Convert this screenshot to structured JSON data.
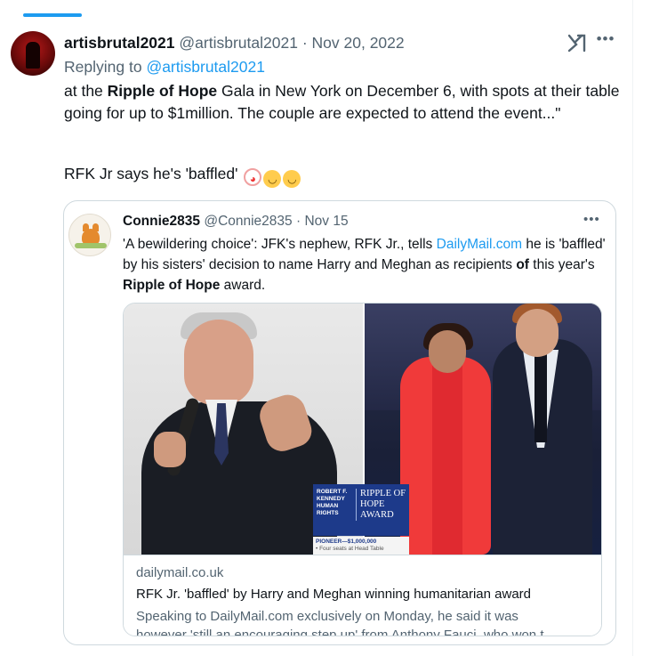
{
  "tweet": {
    "author_name": "artisbrutal2021",
    "author_handle": "@artisbrutal2021",
    "separator": "·",
    "date": "Nov 20, 2022",
    "replying_prefix": "Replying to",
    "replying_handle": "@artisbrutal2021",
    "body_pre": "at the ",
    "body_bold": "Ripple of Hope",
    "body_post": " Gala in New York on December 6, with spots at their table going for up to $1million. The couple are expected to attend the event...\"",
    "line2": "RFK Jr says he's 'baffled'",
    "emojis": [
      "clown-face",
      "grinning-sweat-face",
      "winking-face"
    ],
    "icons": [
      "grok-icon",
      "more-icon"
    ]
  },
  "quote": {
    "author_name": "Connie2835",
    "author_handle": "@Connie2835",
    "separator": "·",
    "date": "Nov 15",
    "text_1": "'A bewildering choice': JFK's nephew, RFK Jr., tells ",
    "text_link": "DailyMail.com",
    "text_2": " he is 'baffled' by his sisters' decision to name Harry and Meghan as recipients ",
    "text_of": "of",
    "text_3": " this year's ",
    "text_bold": "Ripple of Hope",
    "text_4": " award."
  },
  "card": {
    "badge_left": "ROBERT F. KENNEDY HUMAN RIGHTS",
    "badge_right": "RIPPLE OF HOPE AWARD",
    "pioneer": "PIONEER—$1,000,000",
    "pioneer_sub": "• Four seats at Head Table",
    "domain": "dailymail.co.uk",
    "title": "RFK Jr. 'baffled' by Harry and Meghan winning humanitarian award",
    "desc_1": "Speaking to DailyMail.com exclusively on Monday, he said it was",
    "desc_2": "however 'still an encouraging step up' from Anthony Fauci, who won t..."
  },
  "colors": {
    "link": "#1d9bf0",
    "muted": "#536471",
    "text": "#0f1419",
    "border": "#cfd9de"
  }
}
